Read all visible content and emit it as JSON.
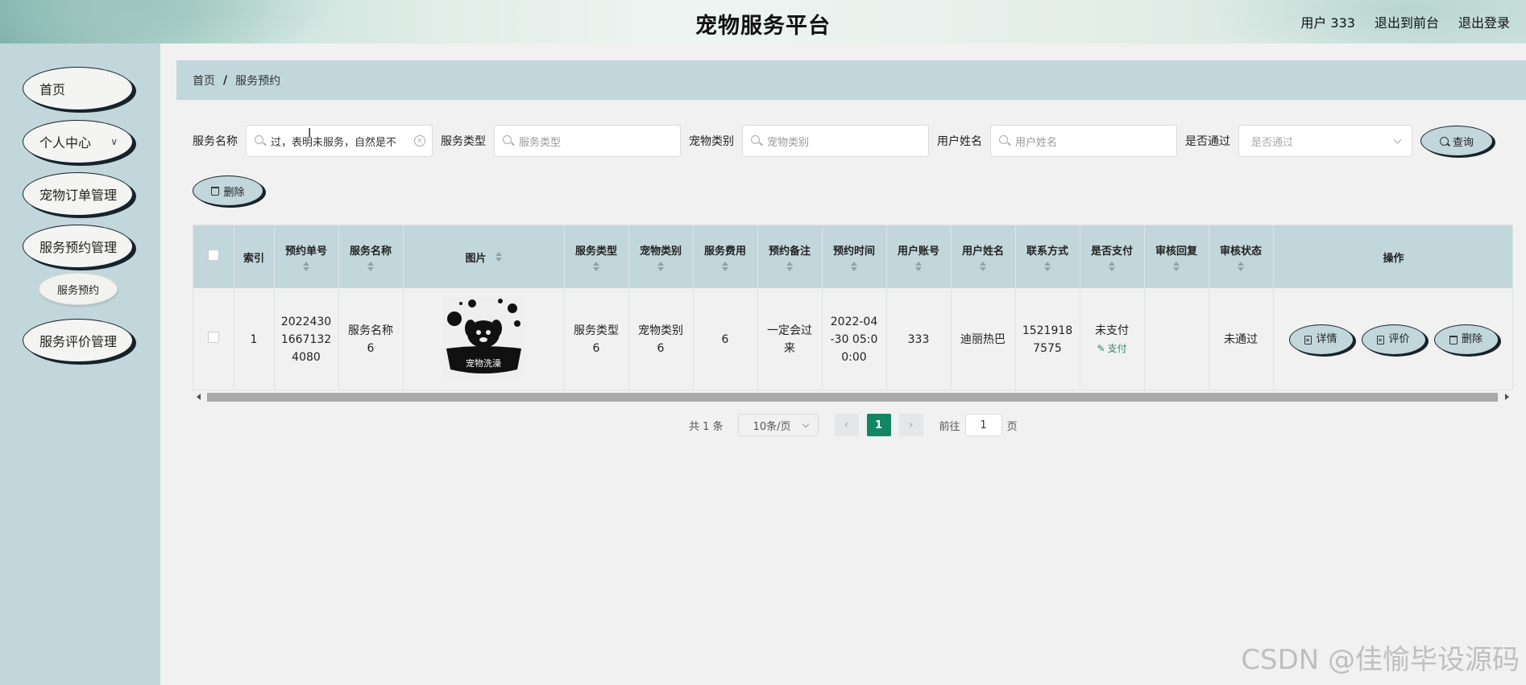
{
  "header": {
    "title": "宠物服务平台",
    "user": "用户 333",
    "back_front": "退出到前台",
    "logout": "退出登录"
  },
  "sidebar": {
    "items": [
      {
        "label": "首页"
      },
      {
        "label": "个人中心"
      },
      {
        "label": "宠物订单管理"
      },
      {
        "label": "服务预约管理"
      },
      {
        "label": "服务评价管理"
      }
    ],
    "sub_item": "服务预约"
  },
  "breadcrumb": {
    "home": "首页",
    "separator": "/",
    "current": "服务预约"
  },
  "search": {
    "service_name_label": "服务名称",
    "service_name_value": "过，表明未服务，自然是不",
    "service_type_label": "服务类型",
    "service_type_placeholder": "服务类型",
    "pet_category_label": "宠物类别",
    "pet_category_placeholder": "宠物类别",
    "user_name_label": "用户姓名",
    "user_name_placeholder": "用户姓名",
    "approved_label": "是否通过",
    "approved_placeholder": "是否通过",
    "query_button": "查询"
  },
  "toolbar": {
    "delete_button": "删除"
  },
  "table": {
    "headers": {
      "index": "索引",
      "order_no": "预约单号",
      "service_name": "服务名称",
      "image": "图片",
      "service_type": "服务类型",
      "pet_category": "宠物类别",
      "service_fee": "服务费用",
      "remark": "预约备注",
      "appointment_time": "预约时间",
      "user_account": "用户账号",
      "user_name": "用户姓名",
      "contact": "联系方式",
      "paid": "是否支付",
      "review_reply": "审核回复",
      "review_status": "审核状态",
      "actions": "操作"
    },
    "rows": [
      {
        "index": "1",
        "order_no": "202243016671324080",
        "service_name": "服务名称6",
        "image_text": "宠物洗澡",
        "service_type": "服务类型6",
        "pet_category": "宠物类别6",
        "service_fee": "6",
        "remark": "一定会过来",
        "appointment_time": "2022-04-30 05:00:00",
        "user_account": "333",
        "user_name": "迪丽热巴",
        "contact": "15219187575",
        "paid": "未支付",
        "pay_link": "支付",
        "review_reply": "",
        "review_status": "未通过",
        "btn_detail": "详情",
        "btn_review": "评价",
        "btn_delete": "删除"
      }
    ]
  },
  "pagination": {
    "total": "共 1 条",
    "page_size": "10条/页",
    "current_page": "1",
    "goto_label": "前往",
    "goto_value": "1",
    "page_suffix": "页"
  },
  "watermark": "CSDN @佳愉毕设源码",
  "colors": {
    "accent": "#128564",
    "panel": "#c2d7db",
    "shadow": "#16232a"
  }
}
